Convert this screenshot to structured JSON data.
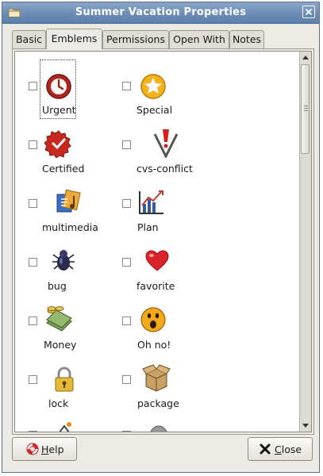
{
  "window": {
    "title": "Summer Vacation Properties",
    "folder_icon": "folder-icon",
    "close_icon": "close-icon"
  },
  "tabs": [
    {
      "label": "Basic",
      "active": false
    },
    {
      "label": "Emblems",
      "active": true
    },
    {
      "label": "Permissions",
      "active": false
    },
    {
      "label": "Open With",
      "active": false
    },
    {
      "label": "Notes",
      "active": false
    }
  ],
  "emblems": [
    {
      "label": "Urgent",
      "icon": "urgent-clock-icon",
      "checked": false
    },
    {
      "label": "Special",
      "icon": "special-star-icon",
      "checked": false
    },
    {
      "label": "Certified",
      "icon": "certified-seal-icon",
      "checked": false
    },
    {
      "label": "cvs-conflict",
      "icon": "cvs-conflict-icon",
      "checked": false
    },
    {
      "label": "multimedia",
      "icon": "multimedia-icon",
      "checked": false
    },
    {
      "label": "Plan",
      "icon": "plan-chart-icon",
      "checked": false
    },
    {
      "label": "bug",
      "icon": "bug-icon",
      "checked": false
    },
    {
      "label": "favorite",
      "icon": "heart-icon",
      "checked": false
    },
    {
      "label": "Money",
      "icon": "money-icon",
      "checked": false
    },
    {
      "label": "Oh no!",
      "icon": "oh-no-face-icon",
      "checked": false
    },
    {
      "label": "lock",
      "icon": "lock-icon",
      "checked": false
    },
    {
      "label": "package",
      "icon": "package-icon",
      "checked": false
    }
  ],
  "buttons": {
    "help_prefix": "",
    "help_mnemonic": "H",
    "help_rest": "elp",
    "close_prefix": "",
    "close_mnemonic": "C",
    "close_rest": "lose"
  },
  "colors": {
    "titlebar": "#6b8db6",
    "window_bg": "#eceae4",
    "list_bg": "#ffffff"
  }
}
